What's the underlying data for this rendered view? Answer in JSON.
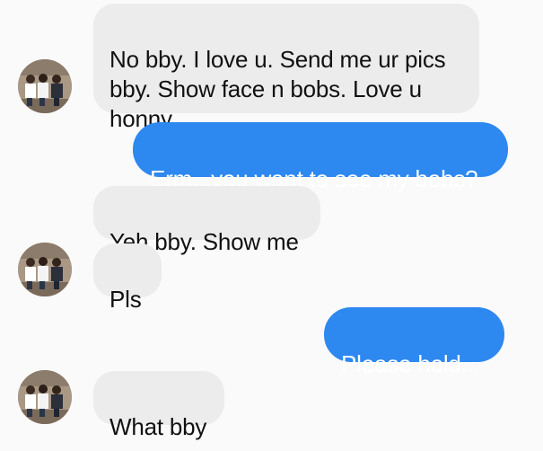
{
  "colors": {
    "background": "#fafafa",
    "incoming_bubble": "#ececec",
    "outgoing_bubble": "#2d88f0",
    "outgoing_text": "#ffffff",
    "incoming_text": "#111111"
  },
  "messages": [
    {
      "direction": "incoming",
      "text": "No bby. I love u. Send me ur pics\nbby. Show face n bobs. Love u\nhonny"
    },
    {
      "direction": "outgoing",
      "text": "Erm...you want to see my bobs?"
    },
    {
      "direction": "incoming",
      "text": "Yeh bby. Show me"
    },
    {
      "direction": "incoming",
      "text": "Pls"
    },
    {
      "direction": "outgoing",
      "text": "Please hold..."
    },
    {
      "direction": "incoming",
      "text": "What bby"
    }
  ],
  "avatars": [
    {
      "icon": "group-photo-avatar"
    },
    {
      "icon": "group-photo-avatar"
    },
    {
      "icon": "group-photo-avatar"
    }
  ]
}
